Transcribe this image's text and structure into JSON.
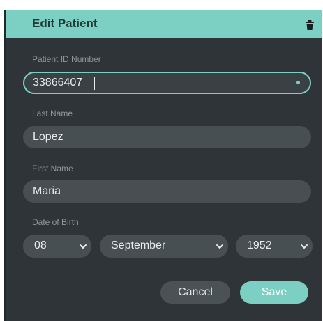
{
  "dialog": {
    "title": "Edit Patient",
    "delete_icon": "trash-icon"
  },
  "fields": {
    "patient_id": {
      "label": "Patient ID Number",
      "value": "33866407"
    },
    "last_name": {
      "label": "Last Name",
      "value": "Lopez"
    },
    "first_name": {
      "label": "First Name",
      "value": "Maria"
    },
    "dob": {
      "label": "Date of Birth",
      "day": "08",
      "month": "September",
      "year": "1952"
    }
  },
  "buttons": {
    "cancel": "Cancel",
    "save": "Save"
  },
  "colors": {
    "accent": "#7ccfc3",
    "background": "#2e3437",
    "field": "#484f52"
  }
}
